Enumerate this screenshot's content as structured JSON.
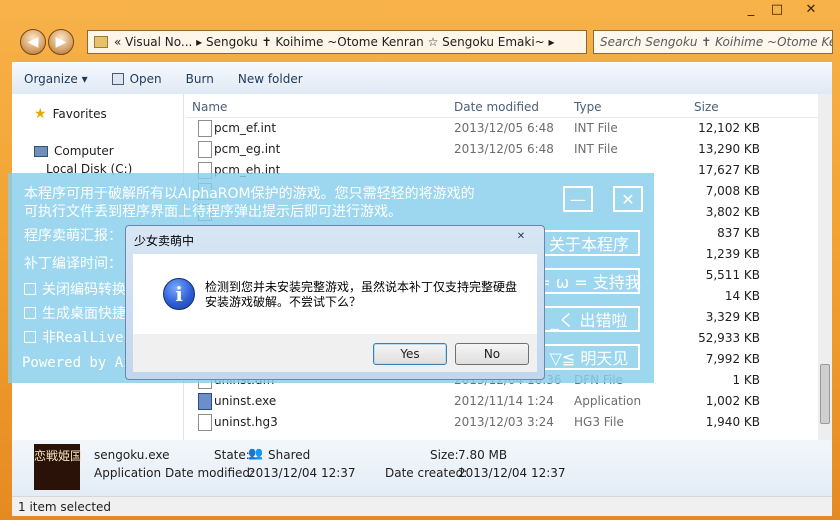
{
  "window": {
    "controls": {
      "minimize": "_",
      "maximize": "□",
      "close": "✕"
    }
  },
  "nav": {
    "address": "« Visual No... ▸ Sengoku ✝ Koihime ~Otome Kenran ☆ Sengoku Emaki~ ▸",
    "search_placeholder": "Search Sengoku ✝ Koihime ~Otome Kenran..."
  },
  "toolbar": {
    "organize": "Organize",
    "open": "Open",
    "burn": "Burn",
    "new_folder": "New folder"
  },
  "sidebar": {
    "favorites": "Favorites",
    "computer": "Computer",
    "local_disk": "Local Disk (C:)"
  },
  "columns": {
    "name": "Name",
    "date": "Date modified",
    "type": "Type",
    "size": "Size"
  },
  "files": [
    {
      "name": "pcm_ef.int",
      "date": "2013/12/05 6:48",
      "type": "INT File",
      "size": "12,102 KB"
    },
    {
      "name": "pcm_eg.int",
      "date": "2013/12/05 6:48",
      "type": "INT File",
      "size": "13,290 KB"
    },
    {
      "name": "pcm_eh.int",
      "date": "",
      "type": "",
      "size": "17,627 KB"
    },
    {
      "name": "",
      "date": "",
      "type": "",
      "size": "7,008 KB"
    },
    {
      "name": "",
      "date": "",
      "type": "",
      "size": "3,802 KB"
    },
    {
      "name": "",
      "date": "",
      "type": "",
      "size": "837 KB"
    },
    {
      "name": "",
      "date": "",
      "type": "",
      "size": "1,239 KB"
    },
    {
      "name": "",
      "date": "",
      "type": "",
      "size": "5,511 KB"
    },
    {
      "name": "",
      "date": "",
      "type": "",
      "size": "14 KB"
    },
    {
      "name": "",
      "date": "",
      "type": "",
      "size": "3,329 KB"
    },
    {
      "name": "",
      "date": "",
      "type": "",
      "size": "52,933 KB"
    },
    {
      "name": "",
      "date": "",
      "type": "",
      "size": "7,992 KB"
    },
    {
      "name": "uninst.dfn",
      "date": "2013/12/04 16:36",
      "type": "DFN File",
      "size": "1 KB"
    },
    {
      "name": "uninst.exe",
      "date": "2012/11/14 1:24",
      "type": "Application",
      "size": "1,002 KB"
    },
    {
      "name": "uninst.hg3",
      "date": "2013/12/03 3:24",
      "type": "HG3 File",
      "size": "1,940 KB"
    }
  ],
  "details": {
    "logo_text": "恋戦姫国",
    "filename": "sengoku.exe",
    "filetype": "Application",
    "state_label": "State:",
    "state_value": "Shared",
    "size_label": "Size:",
    "size_value": "7.80 MB",
    "modified_label": "Date modified:",
    "modified_value": "2013/12/04 12:37",
    "created_label": "Date created:",
    "created_value": "2013/12/04 12:37"
  },
  "status": {
    "text": "1 item selected"
  },
  "overlay": {
    "line1": "本程序可用于破解所有以AlphaROM保护的游戏。您只需轻轻的将游戏的",
    "line2": "可执行文件丢到程序界面上待程序弹出提示后即可进行游戏。",
    "line3": "程序卖萌汇报：",
    "line4": "补丁编译时间：",
    "opt1": "关闭编码转换",
    "opt2": "生成桌面快捷",
    "opt3": "非RealLive引",
    "powered": "Powered by Az",
    "min_btn": "—",
    "close_btn": "✕",
    "about_btn": "关于本程序",
    "support_btn": "= ω =  支持我",
    "error_btn": "_く  出错啦",
    "bye_btn": "▽≦  明天见"
  },
  "dialog": {
    "title": "少女卖萌中",
    "message_line1": "检测到您并未安装完整游戏，虽然说本补丁仅支持完整硬盘",
    "message_line2": "安装游戏破解。不尝试下么？",
    "yes": "Yes",
    "no": "No",
    "close": "✕"
  }
}
